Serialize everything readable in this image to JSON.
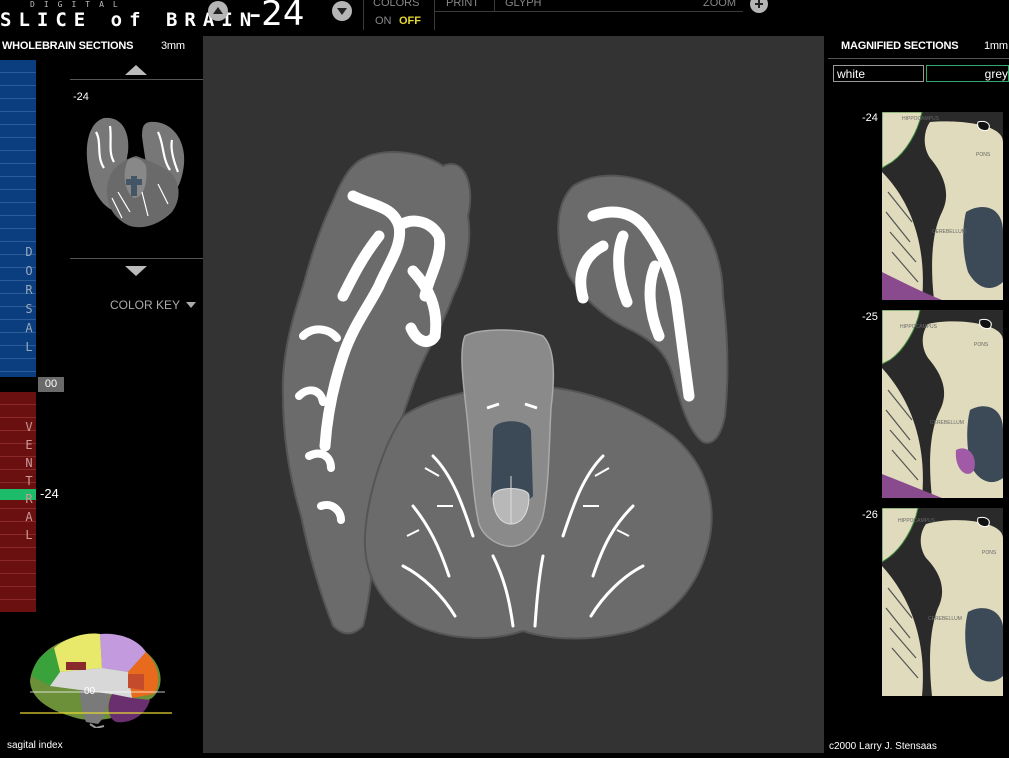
{
  "header": {
    "logo_top": "DIGITAL",
    "logo_bottom": "SLICE of BRAIN",
    "current_slice": "-24",
    "colors_label": "COLORS",
    "colors_on": "ON",
    "colors_off": "OFF",
    "print_label": "PRINT",
    "glyph_label": "GLYPH",
    "zoom_label": "ZOOM",
    "accent_color": "#e8d633"
  },
  "left": {
    "title": "WHOLEBRAIN SECTIONS",
    "thickness": "3mm",
    "thumb_label": "-24",
    "dorsal_letters": [
      "D",
      "O",
      "R",
      "S",
      "A",
      "L"
    ],
    "ventral_letters": [
      "V",
      "E",
      "N",
      "T",
      "R",
      "A",
      "L"
    ],
    "zero_label": "00",
    "current_label": "-24",
    "color_key": "COLOR KEY",
    "sagital_zero": "00",
    "sagital_caption": "sagital index",
    "dorsal_color": "#0b3e7e",
    "ventral_color": "#6b1010",
    "marker_color": "#1dbc6b"
  },
  "right": {
    "title": "MAGNIFIED SECTIONS",
    "thickness": "1mm",
    "field_white": "white",
    "field_grey": "grey",
    "sections": [
      {
        "label": "-24",
        "t1": "HIPPOCAMPUS",
        "t2": "PONS",
        "t3": "CEREBELLUM"
      },
      {
        "label": "-25",
        "t1": "HIPPOCAMPUS",
        "t2": "PONS",
        "t3": "CEREBELLUM"
      },
      {
        "label": "-26",
        "t1": "HIPPOCAMPUS",
        "t2": "PONS",
        "t3": "CEREBELLUM"
      }
    ],
    "credit": "c2000 Larry J. Stensaas"
  }
}
